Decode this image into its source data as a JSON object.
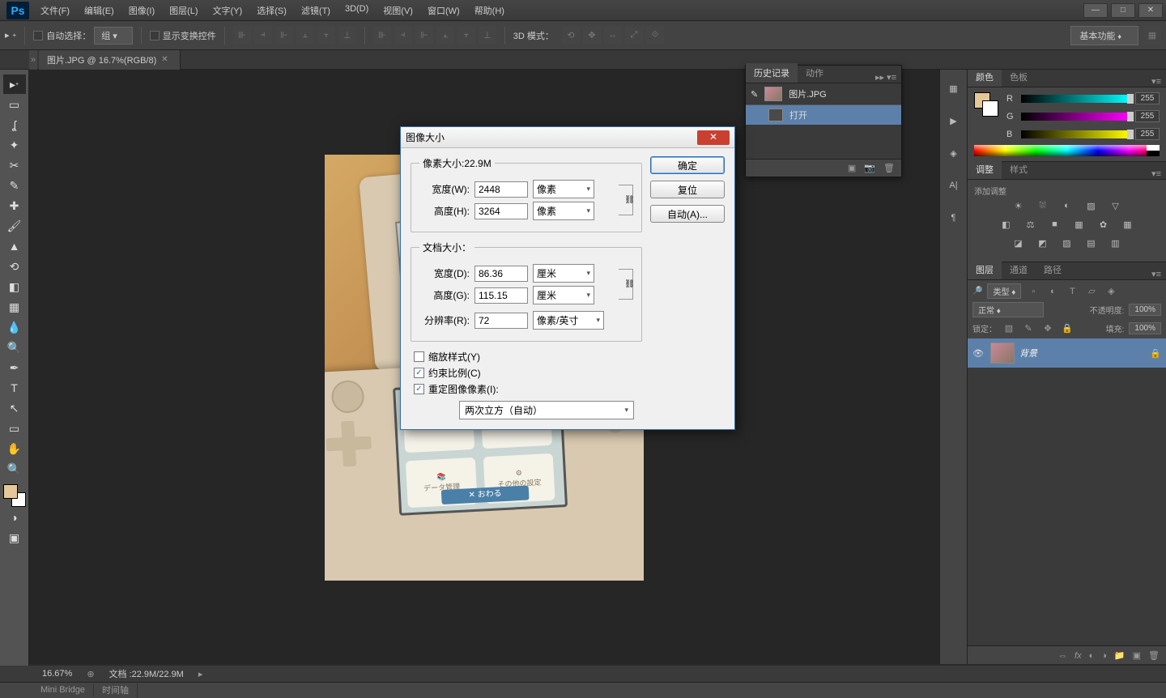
{
  "menubar": [
    "文件(F)",
    "编辑(E)",
    "图像(I)",
    "图层(L)",
    "文字(Y)",
    "选择(S)",
    "滤镜(T)",
    "3D(D)",
    "视图(V)",
    "窗口(W)",
    "帮助(H)"
  ],
  "options": {
    "auto_select": "自动选择：",
    "group_sel": "组",
    "show_transform": "显示变换控件",
    "mode3d": "3D 模式：",
    "workspace": "基本功能"
  },
  "doctab": {
    "title": "图片.JPG @ 16.7%(RGB/8)"
  },
  "history": {
    "tab1": "历史记录",
    "tab2": "动作",
    "snapshot": "图片.JPG",
    "step1": "打开"
  },
  "color": {
    "tab1": "颜色",
    "tab2": "色板",
    "r": "R",
    "g": "G",
    "b": "B",
    "rv": "255",
    "gv": "255",
    "bv": "255"
  },
  "adjust": {
    "tab1": "调整",
    "tab2": "样式",
    "label": "添加调整"
  },
  "layers": {
    "tab1": "图层",
    "tab2": "通道",
    "tab3": "路径",
    "kind": "类型",
    "blend": "正常",
    "opacity_label": "不透明度:",
    "opacity_val": "100%",
    "lock_label": "锁定：",
    "fill_label": "填充:",
    "fill_val": "100%",
    "layer_name": "背景"
  },
  "dialog": {
    "title": "图像大小",
    "pixel_legend": "像素大小:22.9M",
    "w_label": "宽度(W):",
    "w_val": "2448",
    "h_label": "高度(H):",
    "h_val": "3264",
    "unit_px": "像素",
    "doc_legend": "文档大小：",
    "dw_label": "宽度(D):",
    "dw_val": "86.36",
    "dh_label": "高度(G):",
    "dh_val": "115.15",
    "res_label": "分辨率(R):",
    "res_val": "72",
    "unit_cm": "厘米",
    "unit_ppi": "像素/英寸",
    "scale_styles": "缩放样式(Y)",
    "constrain": "约束比例(C)",
    "resample": "重定图像像素(I):",
    "interp": "两次立方（自动）",
    "ok": "确定",
    "cancel": "复位",
    "auto": "自动(A)..."
  },
  "status": {
    "zoom": "16.67%",
    "doc": "文档 :22.9M/22.9M"
  },
  "bottomtabs": {
    "t1": "Mini Bridge",
    "t2": "时间轴"
  },
  "canvas": {
    "app1": "データ管理",
    "app2": "その他の設定",
    "bar": "✕ おわる"
  }
}
